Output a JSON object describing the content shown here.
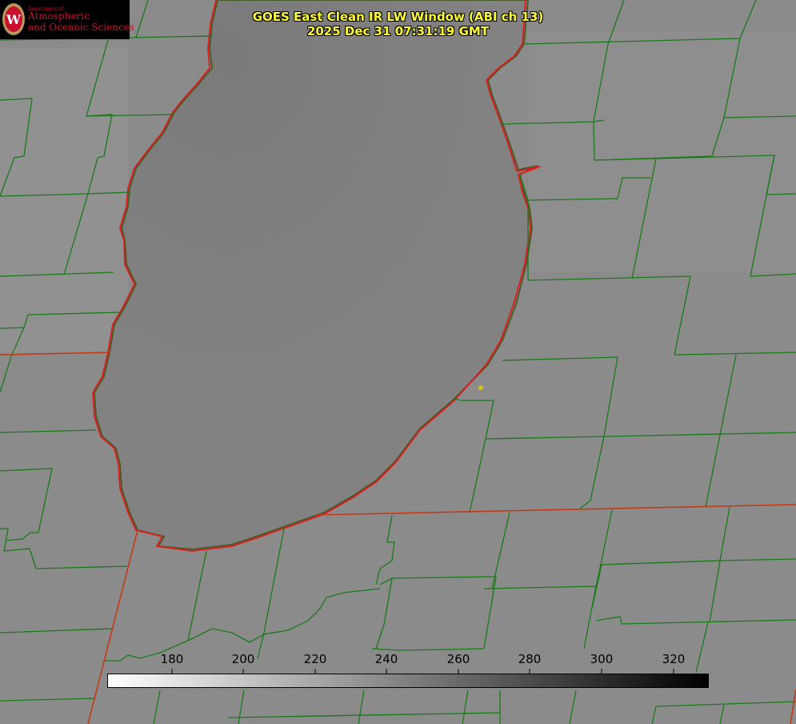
{
  "logo": {
    "dept": "Department of",
    "line1": "Atmospheric",
    "line2": "and Oceanic Sciences",
    "icon": "uw-crest-icon"
  },
  "title": {
    "line1": "GOES East Clean IR LW Window (ABI ch 13)",
    "line2": "2025 Dec 31 07:31:19 GMT"
  },
  "colorbar": {
    "ticks": [
      "180",
      "200",
      "220",
      "240",
      "260",
      "280",
      "300",
      "320"
    ]
  },
  "colors": {
    "county_lines": "#1a7a1a",
    "state_and_lake_outline": "#e01c1c",
    "station_marker": "#d8c010",
    "title_text": "#ffff33"
  }
}
